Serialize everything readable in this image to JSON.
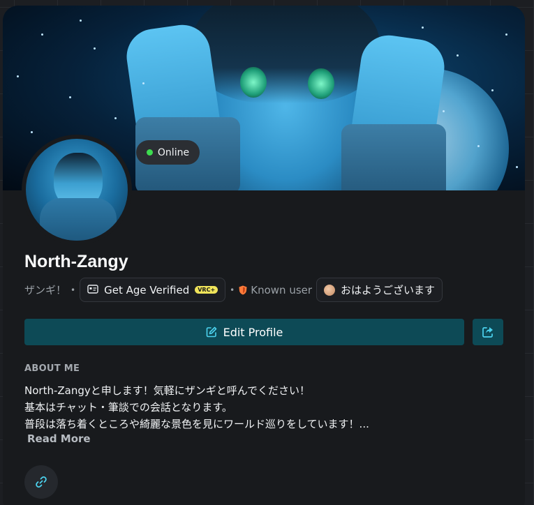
{
  "profile": {
    "status": "Online",
    "username": "North-Zangy",
    "tagline": "ザンギ！",
    "age_verify_label": "Get Age Verified",
    "age_verify_badge": "VRC+",
    "trust_rank": "Known user",
    "status_message": "おはようございます"
  },
  "actions": {
    "edit_label": "Edit Profile"
  },
  "about": {
    "title": "ABOUT ME",
    "lines": [
      "North-Zangyと申します！気軽にザンギと呼んでください！",
      "基本はチャット・筆談での会話となります。",
      "普段は落ち着くところや綺麗な景色を見にワールド巡りをしています！..."
    ],
    "read_more": "Read More"
  },
  "colors": {
    "online": "#3ddc4f",
    "button": "#0d4a56",
    "trust_known": "#ff7b3a",
    "accent_icon": "#4cd3ef"
  },
  "icons": {
    "status": "status-dot-icon",
    "age": "id-card-icon",
    "trust": "shield-icon",
    "edit": "edit-icon",
    "share": "share-icon",
    "link": "link-icon"
  }
}
